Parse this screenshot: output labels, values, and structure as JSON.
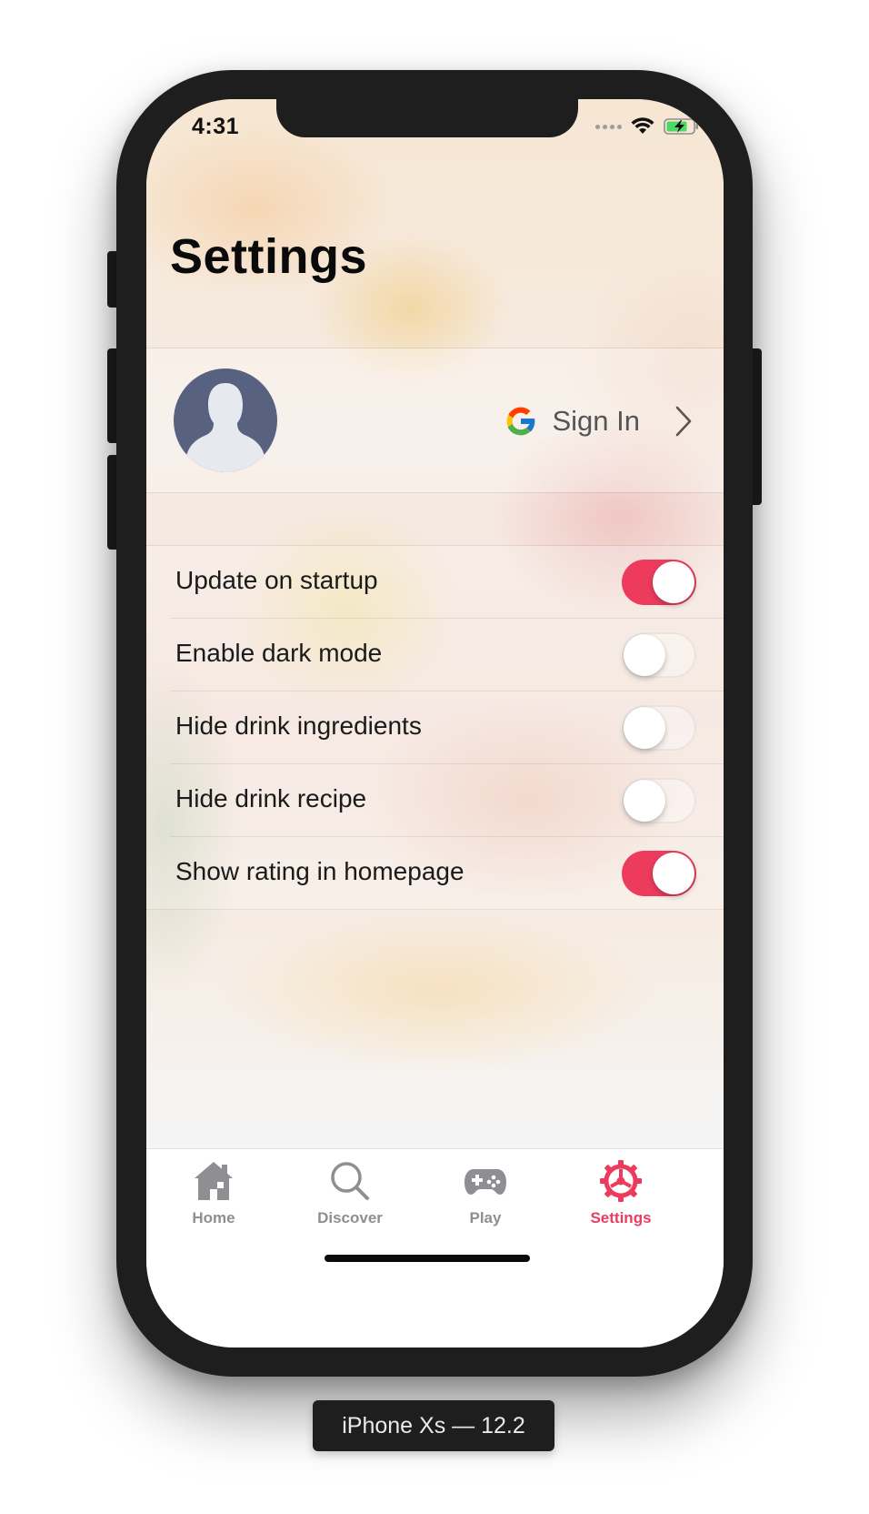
{
  "status_bar": {
    "time": "4:31"
  },
  "page": {
    "title": "Settings"
  },
  "profile": {
    "sign_in_label": "Sign In",
    "avatar_icon": "person-placeholder-icon",
    "provider_icon": "google-icon",
    "disclosure_icon": "chevron-right-icon"
  },
  "settings": {
    "items": [
      {
        "label": "Update on startup",
        "enabled": true
      },
      {
        "label": "Enable dark mode",
        "enabled": false
      },
      {
        "label": "Hide drink ingredients",
        "enabled": false
      },
      {
        "label": "Hide drink recipe",
        "enabled": false
      },
      {
        "label": "Show rating in homepage",
        "enabled": true
      }
    ]
  },
  "tab_bar": {
    "tabs": [
      {
        "label": "Home",
        "icon": "home-icon",
        "active": false
      },
      {
        "label": "Discover",
        "icon": "search-icon",
        "active": false
      },
      {
        "label": "Play",
        "icon": "gamepad-icon",
        "active": false
      },
      {
        "label": "Settings",
        "icon": "gear-icon",
        "active": true
      }
    ]
  },
  "device": {
    "caption": "iPhone Xs — 12.2"
  },
  "colors": {
    "accent": "#ec3b5c",
    "tab_inactive": "#8e8e93",
    "avatar_bg": "#58617f",
    "device_frame": "#1e1e1e"
  }
}
